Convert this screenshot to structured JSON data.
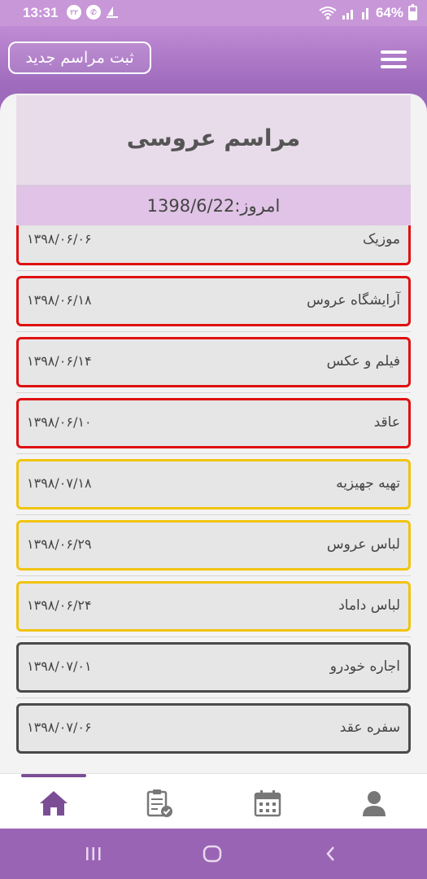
{
  "status_bar": {
    "time": "13:31",
    "notif_badge": "۲۲",
    "battery": "64%",
    "battery_level": 0.64
  },
  "header": {
    "new_button_label": "ثبت مراسم جدید",
    "menu_icon": "hamburger-icon"
  },
  "card": {
    "title": "مراسم عروسی",
    "today": "امروز:1398/6/22"
  },
  "items": [
    {
      "title": "موزیک",
      "date": "۱۳۹۸/۰۶/۰۶",
      "status": "red"
    },
    {
      "title": "آرایشگاه عروس",
      "date": "۱۳۹۸/۰۶/۱۸",
      "status": "red"
    },
    {
      "title": "فیلم و عکس",
      "date": "۱۳۹۸/۰۶/۱۴",
      "status": "red"
    },
    {
      "title": "عاقد",
      "date": "۱۳۹۸/۰۶/۱۰",
      "status": "red"
    },
    {
      "title": "تهیه جهیزیه",
      "date": "۱۳۹۸/۰۷/۱۸",
      "status": "yellow"
    },
    {
      "title": "لباس عروس",
      "date": "۱۳۹۸/۰۶/۲۹",
      "status": "yellow"
    },
    {
      "title": "لباس داماد",
      "date": "۱۳۹۸/۰۶/۲۴",
      "status": "yellow"
    },
    {
      "title": "اجاره خودرو",
      "date": "۱۳۹۸/۰۷/۰۱",
      "status": "gray"
    },
    {
      "title": "سفره عقد",
      "date": "۱۳۹۸/۰۷/۰۶",
      "status": "gray"
    }
  ],
  "bottom_nav": [
    {
      "icon": "home-icon",
      "active": true
    },
    {
      "icon": "checklist-icon",
      "active": false
    },
    {
      "icon": "calendar-icon",
      "active": false
    },
    {
      "icon": "profile-icon",
      "active": false
    }
  ],
  "colors": {
    "accent": "#9a67b8",
    "red": "#e01010",
    "yellow": "#f1c40f",
    "gray": "#4a4a4a"
  }
}
